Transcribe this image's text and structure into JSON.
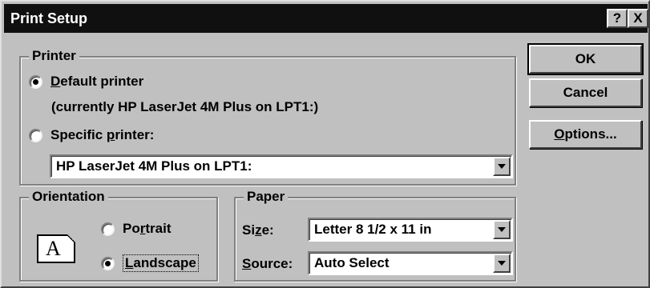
{
  "window": {
    "title": "Print Setup",
    "help_label": "?",
    "close_label": "X"
  },
  "printer": {
    "legend": "Printer",
    "default": {
      "label": "Default printer",
      "accel": "D",
      "rest": "efault printer",
      "checked": true
    },
    "current_info": "(currently HP LaserJet 4M Plus on LPT1:)",
    "specific": {
      "label": "Specific printer:",
      "pre": "Specific ",
      "accel": "p",
      "rest": "rinter:",
      "checked": false
    },
    "specific_select_value": "HP LaserJet 4M Plus on LPT1:"
  },
  "orientation": {
    "legend": "Orientation",
    "icon_letter": "A",
    "portrait": {
      "label": "Portrait",
      "pre": "Po",
      "accel": "r",
      "rest": "trait",
      "checked": false
    },
    "landscape": {
      "label": "Landscape",
      "accel": "L",
      "rest": "andscape",
      "checked": true
    }
  },
  "paper": {
    "legend": "Paper",
    "size": {
      "label": "Size:",
      "pre": "Si",
      "accel": "z",
      "rest": "e:",
      "value": "Letter 8 1/2 x 11 in"
    },
    "source": {
      "label": "Source:",
      "accel": "S",
      "rest": "ource:",
      "value": "Auto Select"
    }
  },
  "buttons": {
    "ok": "OK",
    "cancel": "Cancel",
    "options": {
      "label": "Options...",
      "accel": "O",
      "rest": "ptions..."
    }
  },
  "colors": {
    "face": "#c0c0c0",
    "titlebar": "#101010",
    "title_text": "#ffffff"
  }
}
